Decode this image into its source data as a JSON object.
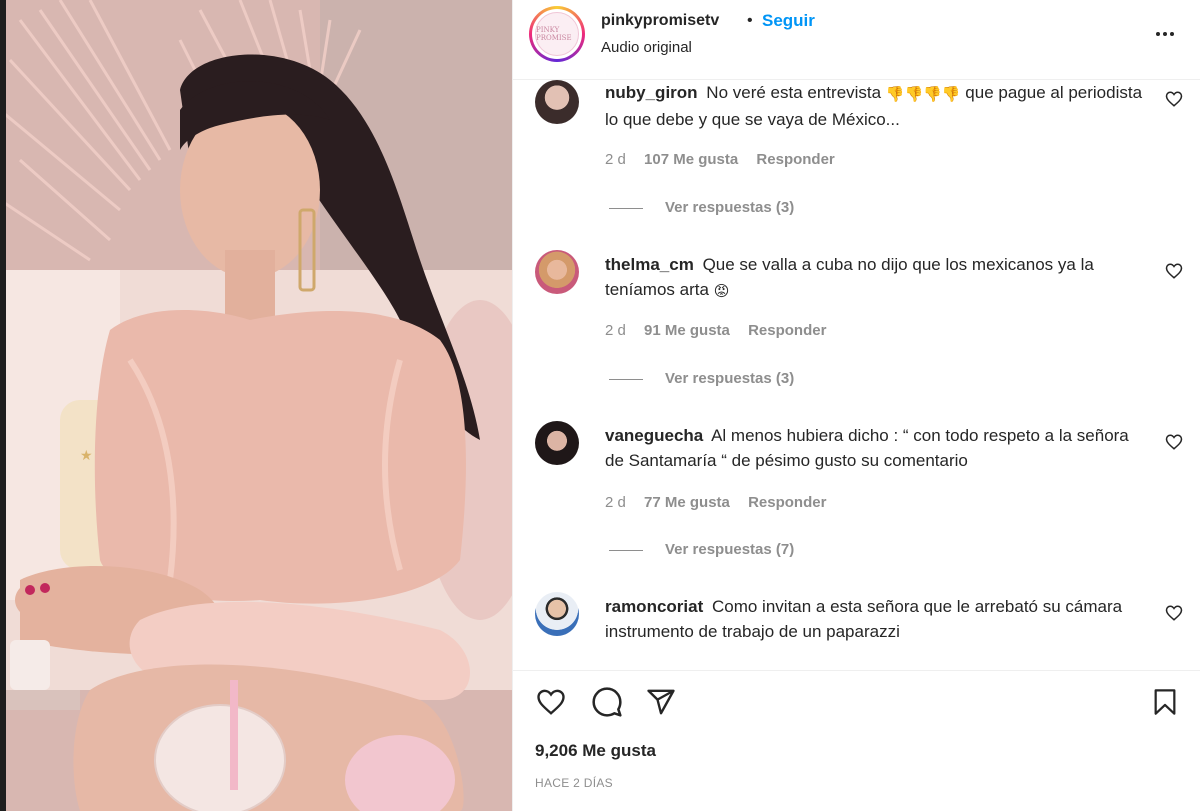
{
  "post": {
    "username": "pinkypromisetv",
    "separator": "•",
    "follow_label": "Seguir",
    "audio_label": "Audio original",
    "avatar_text": "PINKY PROMISE"
  },
  "comments": [
    {
      "username": "nuby_giron",
      "text_before": "No veré esta entrevista",
      "emojis": "👎👎👎👎",
      "text_after": "que pague al periodista lo que debe y que se vaya de México...",
      "time": "2 d",
      "likes": "107 Me gusta",
      "reply_label": "Responder",
      "replies": "Ver respuestas (3)"
    },
    {
      "username": "thelma_cm",
      "text_before": "Que se valla a cuba no dijo que los mexicanos ya la teníamos arta",
      "emojis": "😡",
      "text_after": "",
      "time": "2 d",
      "likes": "91 Me gusta",
      "reply_label": "Responder",
      "replies": "Ver respuestas (3)"
    },
    {
      "username": "vaneguecha",
      "text_before": "Al menos hubiera dicho : “ con todo respeto a la señora de Santamaría “ de pésimo gusto su comentario",
      "emojis": "",
      "text_after": "",
      "time": "2 d",
      "likes": "77 Me gusta",
      "reply_label": "Responder",
      "replies": "Ver respuestas (7)"
    },
    {
      "username": "ramoncoriat",
      "text_before": "Como invitan a esta señora que le arrebató su cámara instrumento de trabajo de un paparazzi",
      "emojis": "",
      "text_after": "",
      "time": "",
      "likes": "",
      "reply_label": "",
      "replies": ""
    }
  ],
  "footer": {
    "likes_total": "9,206 Me gusta",
    "date": "HACE 2 DÍAS"
  },
  "icons": {
    "like": "heart-icon",
    "comment": "comment-bubble-icon",
    "share": "paper-plane-icon",
    "save": "bookmark-icon",
    "more": "more-options-icon",
    "comment_like": "heart-icon"
  },
  "colors": {
    "accent": "#0095f6",
    "text": "#262626",
    "muted": "#8e8e8e",
    "divider": "#efefef"
  }
}
